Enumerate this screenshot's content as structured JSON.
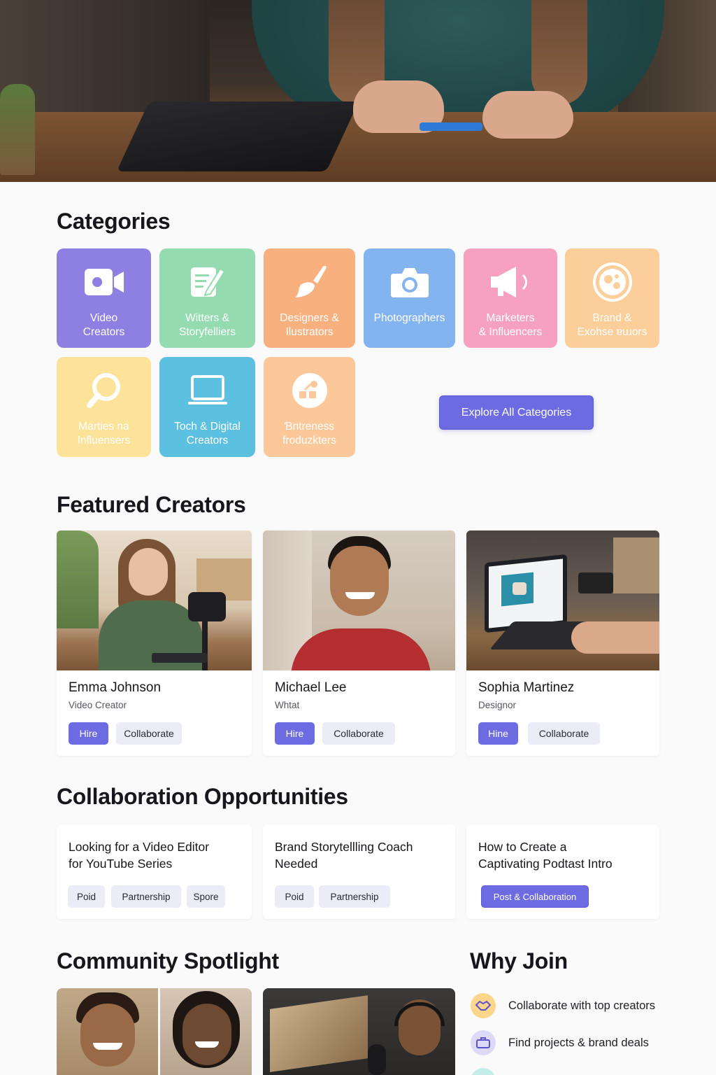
{
  "sections": {
    "categories": "Categories",
    "featured": "Featured Creators",
    "collaboration": "Collaboration Opportunities",
    "community": "Community Spotlight",
    "why": "Why Join"
  },
  "categories": [
    {
      "label": "Video\nCreators",
      "icon": "video-camera-icon",
      "color": "#8e7fe3"
    },
    {
      "label": "Witters &\nStoryfelliers",
      "icon": "notepad-pen-icon",
      "color": "#94dbb0"
    },
    {
      "label": "Designers &\nIlustrators",
      "icon": "paintbrush-icon",
      "color": "#f9b07f"
    },
    {
      "label": "Photographers",
      "icon": "camera-icon",
      "color": "#84b4f0"
    },
    {
      "label": "Marketers\n& Influencers",
      "icon": "megaphone-icon",
      "color": "#f7a1c1"
    },
    {
      "label": "Brand &\nExohse ɐuɹors",
      "icon": "palette-icon",
      "color": "#fcce9a"
    },
    {
      "label": "Marties na\nInfluensers",
      "icon": "magnifier-icon",
      "color": "#fde39a"
    },
    {
      "label": "Toch & Digital\nCreators",
      "icon": "monitor-icon",
      "color": "#5cc0e0"
    },
    {
      "label": "Ɓntreness\nfroduzkters",
      "icon": "shapes-icon",
      "color": "#fcc89a"
    }
  ],
  "explore_label": "Explore All Categories",
  "creators": [
    {
      "name": "Emma Johnson",
      "role": "Video Creator",
      "hire": "Hire",
      "collab": "Collaborate"
    },
    {
      "name": "Michael Lee",
      "role": "Whtat",
      "hire": "Hire",
      "collab": "Collaborate"
    },
    {
      "name": "Sophia Martinez",
      "role": "Designor",
      "hire": "Hine",
      "collab": "Collaborate"
    }
  ],
  "opportunities": [
    {
      "title": "Looking for a Video Editor\nfor YouTube Series",
      "tags": [
        "Poid",
        "Partnership",
        "Spore"
      ]
    },
    {
      "title": "Brand Storytellling Coach\nNeeded",
      "tags": [
        "Poid",
        "Partnership"
      ]
    },
    {
      "title": "How to Create a\nCaptivating Podtast Intro",
      "tags": [
        "Post & Collaboration"
      ]
    }
  ],
  "why": [
    {
      "text": "Collaborate with top creators",
      "icon": "handshake-icon",
      "color": "#fcd68a"
    },
    {
      "text": "Find projects & brand deals",
      "icon": "briefcase-icon",
      "color": "#dcdaf7"
    }
  ]
}
